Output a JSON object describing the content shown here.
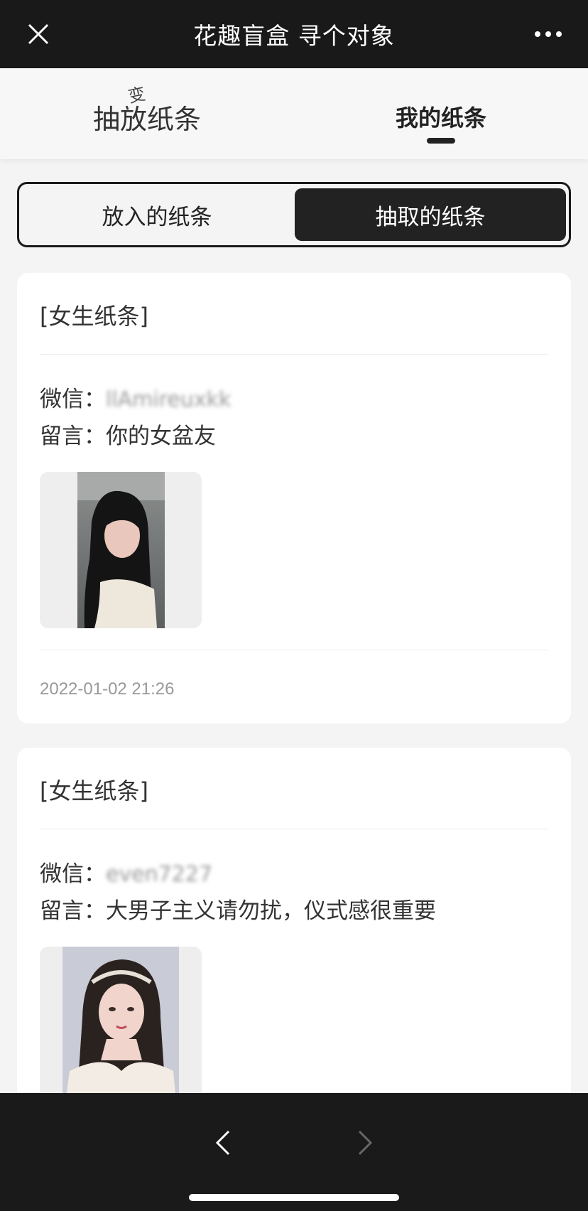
{
  "app": {
    "title": "花趣盲盒 寻个对象",
    "close_icon": "close-icon",
    "more_icon": "more-dots-icon"
  },
  "tabs": {
    "left_label": "抽放纸条",
    "left_overlay": "变",
    "right_label": "我的纸条",
    "active": "我的纸条"
  },
  "segment": {
    "options": [
      "放入的纸条",
      "抽取的纸条"
    ],
    "selected": "抽取的纸条"
  },
  "notes": [
    {
      "title": "[女生纸条]",
      "wechat_label": "微信：",
      "wechat_value": "llAmireuxkk",
      "message_label": "留言：",
      "message_value": "你的女盆友",
      "time": "2022-01-02 21:26",
      "photo": "portrait-photo"
    },
    {
      "title": "[女生纸条]",
      "wechat_label": "微信：",
      "wechat_value": "even7227",
      "message_label": "留言：",
      "message_value": "大男子主义请勿扰，仪式感很重要",
      "photo": "portrait-photo"
    }
  ],
  "colors": {
    "topbar": "#191919",
    "accent": "#222222",
    "card": "#ffffff",
    "background": "#f4f4f4"
  },
  "bottom_nav": {
    "back_icon": "chevron-left-icon",
    "forward_icon": "chevron-right-icon"
  }
}
